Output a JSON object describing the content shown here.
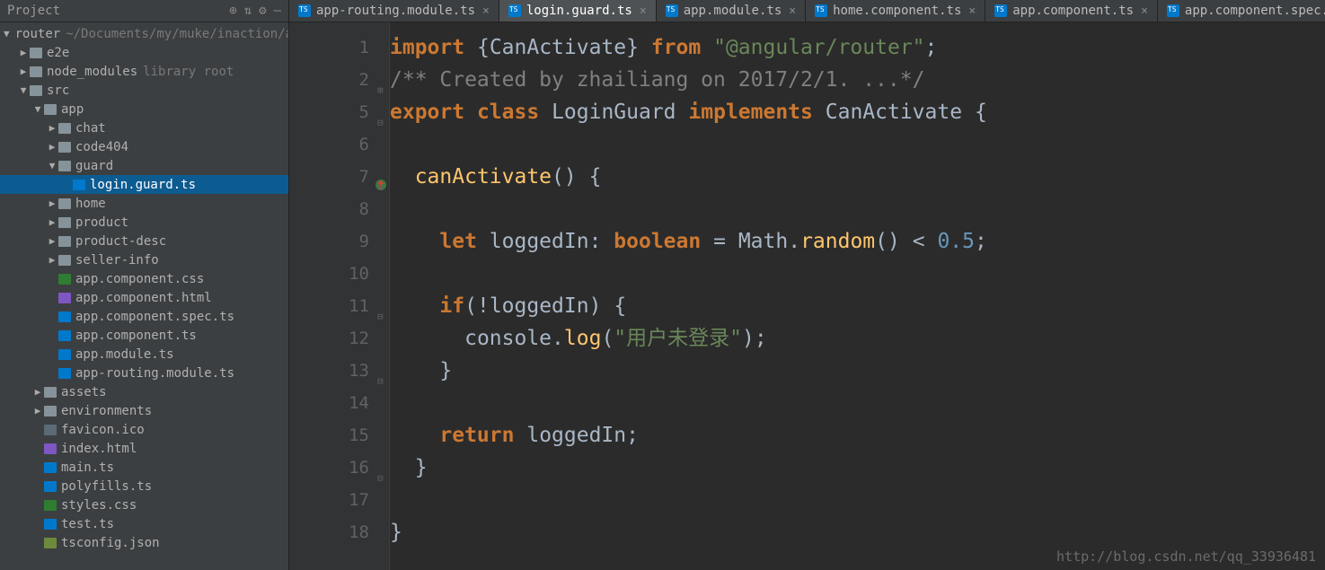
{
  "panel": {
    "title": "Project",
    "icons": [
      "target",
      "collapse",
      "gear",
      "hide"
    ]
  },
  "tabs": [
    {
      "label": "app-routing.module.ts",
      "active": false
    },
    {
      "label": "login.guard.ts",
      "active": true
    },
    {
      "label": "app.module.ts",
      "active": false
    },
    {
      "label": "home.component.ts",
      "active": false
    },
    {
      "label": "app.component.ts",
      "active": false
    },
    {
      "label": "app.component.spec.ts",
      "active": false
    }
  ],
  "tree": [
    {
      "depth": 0,
      "arrow": "down",
      "icon": "folder",
      "label": "router",
      "extra": "~/Documents/my/muke/inaction/a"
    },
    {
      "depth": 1,
      "arrow": "right",
      "icon": "folder",
      "label": "e2e"
    },
    {
      "depth": 1,
      "arrow": "right",
      "icon": "folder",
      "label": "node_modules",
      "extra": "library root"
    },
    {
      "depth": 1,
      "arrow": "down",
      "icon": "folder",
      "label": "src"
    },
    {
      "depth": 2,
      "arrow": "down",
      "icon": "folder",
      "label": "app"
    },
    {
      "depth": 3,
      "arrow": "right",
      "icon": "folder",
      "label": "chat"
    },
    {
      "depth": 3,
      "arrow": "right",
      "icon": "folder",
      "label": "code404"
    },
    {
      "depth": 3,
      "arrow": "down",
      "icon": "folder",
      "label": "guard"
    },
    {
      "depth": 4,
      "arrow": "",
      "icon": "ts",
      "label": "login.guard.ts",
      "selected": true
    },
    {
      "depth": 3,
      "arrow": "right",
      "icon": "folder",
      "label": "home"
    },
    {
      "depth": 3,
      "arrow": "right",
      "icon": "folder",
      "label": "product"
    },
    {
      "depth": 3,
      "arrow": "right",
      "icon": "folder",
      "label": "product-desc"
    },
    {
      "depth": 3,
      "arrow": "right",
      "icon": "folder",
      "label": "seller-info"
    },
    {
      "depth": 3,
      "arrow": "",
      "icon": "css",
      "label": "app.component.css"
    },
    {
      "depth": 3,
      "arrow": "",
      "icon": "html",
      "label": "app.component.html"
    },
    {
      "depth": 3,
      "arrow": "",
      "icon": "ts",
      "label": "app.component.spec.ts"
    },
    {
      "depth": 3,
      "arrow": "",
      "icon": "ts",
      "label": "app.component.ts"
    },
    {
      "depth": 3,
      "arrow": "",
      "icon": "ts",
      "label": "app.module.ts"
    },
    {
      "depth": 3,
      "arrow": "",
      "icon": "ts",
      "label": "app-routing.module.ts"
    },
    {
      "depth": 2,
      "arrow": "right",
      "icon": "folder",
      "label": "assets"
    },
    {
      "depth": 2,
      "arrow": "right",
      "icon": "folder",
      "label": "environments"
    },
    {
      "depth": 2,
      "arrow": "",
      "icon": "ico",
      "label": "favicon.ico"
    },
    {
      "depth": 2,
      "arrow": "",
      "icon": "html",
      "label": "index.html"
    },
    {
      "depth": 2,
      "arrow": "",
      "icon": "ts",
      "label": "main.ts"
    },
    {
      "depth": 2,
      "arrow": "",
      "icon": "ts",
      "label": "polyfills.ts"
    },
    {
      "depth": 2,
      "arrow": "",
      "icon": "css",
      "label": "styles.css"
    },
    {
      "depth": 2,
      "arrow": "",
      "icon": "ts",
      "label": "test.ts"
    },
    {
      "depth": 2,
      "arrow": "",
      "icon": "json",
      "label": "tsconfig.json"
    }
  ],
  "line_numbers": [
    "1",
    "2",
    "5",
    "6",
    "7",
    "8",
    "9",
    "10",
    "11",
    "12",
    "13",
    "14",
    "15",
    "16",
    "17",
    "18"
  ],
  "code": {
    "l1": {
      "import": "import",
      "lb": "{",
      "can": "CanActivate",
      "rb": "}",
      "from": "from",
      "str": "\"@angular/router\"",
      "semi": ";"
    },
    "l2": {
      "comment": "/** Created by zhailiang on 2017/2/1. ...*/"
    },
    "l5": {
      "export": "export",
      "class": "class",
      "name": "LoginGuard",
      "implements": "implements",
      "iface": "CanActivate",
      "lb": "{"
    },
    "l7": {
      "fn": "canActivate",
      "paren": "()",
      "lb": "{"
    },
    "l9": {
      "let": "let",
      "var": "loggedIn",
      "colon": ":",
      "type": "boolean",
      "eq": "=",
      "obj": "Math",
      "dot": ".",
      "method": "random",
      "paren": "()",
      "lt": "<",
      "num": "0.5",
      "semi": ";"
    },
    "l11": {
      "if": "if",
      "lp": "(",
      "bang": "!",
      "var": "loggedIn",
      "rp": ")",
      "lb": "{"
    },
    "l12": {
      "obj": "console",
      "dot": ".",
      "method": "log",
      "lp": "(",
      "str": "\"用户未登录\"",
      "rp": ")",
      "semi": ";"
    },
    "l13": {
      "rb": "}"
    },
    "l15": {
      "return": "return",
      "var": "loggedIn",
      "semi": ";"
    },
    "l16": {
      "rb": "}"
    },
    "l18": {
      "rb": "}"
    }
  },
  "watermark": "http://blog.csdn.net/qq_33936481"
}
